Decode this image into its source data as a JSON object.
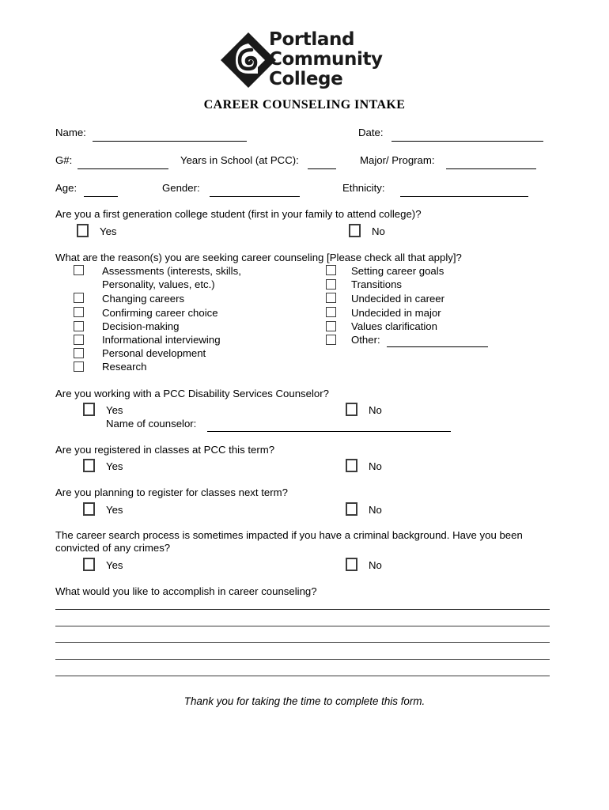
{
  "logo": {
    "mark_icon": "pcc-spiral-diamond-logo",
    "line1": "Portland",
    "line2": "Community",
    "line3": "College"
  },
  "title": "CAREER COUNSELING INTAKE",
  "fields": {
    "name_label": "Name:",
    "date_label": "Date:",
    "gnumber_label": "G#:",
    "years_label": "Years in School (at PCC):",
    "major_label": "Major/ Program:",
    "age_label": "Age:",
    "gender_label": "Gender:",
    "ethnicity_label": "Ethnicity:"
  },
  "q_first_gen": {
    "question": "Are you a first generation college student (first in your family to attend college)?",
    "yes": "Yes",
    "no": "No"
  },
  "q_reasons": {
    "question": "What are the reason(s) you are seeking career counseling [Please check all that apply]?",
    "left_options": [
      "Assessments (interests, skills,",
      "Personality, values, etc.)",
      "Changing careers",
      "Confirming career choice",
      "Decision-making",
      "Informational interviewing",
      "Personal development",
      "Research"
    ],
    "right_options": [
      "Setting career goals",
      "Transitions",
      "Undecided in career",
      "Undecided in major",
      "Values clarification",
      "Other:"
    ]
  },
  "q_disability": {
    "question": "Are you working with a PCC Disability Services Counselor?",
    "yes": "Yes",
    "no": "No",
    "counselor_label": "Name of counselor:"
  },
  "q_registered": {
    "question": "Are you registered in classes at PCC this term?",
    "yes": "Yes",
    "no": "No"
  },
  "q_planning": {
    "question": "Are you planning to register for classes next term?",
    "yes": "Yes",
    "no": "No"
  },
  "q_criminal": {
    "question": "The career search process is sometimes impacted if you have a criminal background. Have you been convicted of any crimes?",
    "yes": "Yes",
    "no": "No"
  },
  "q_accomplish": {
    "question": "What would you like to accomplish in career counseling?"
  },
  "footer": "Thank you for taking the time to complete this form."
}
